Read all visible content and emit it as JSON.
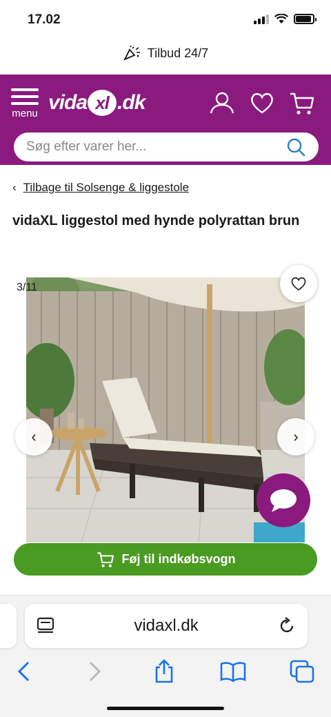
{
  "status_bar": {
    "time": "17.02",
    "battery_level": 0.9
  },
  "promo": {
    "text": "Tilbud 24/7"
  },
  "header": {
    "menu_label": "menu",
    "logo_text_left": "vida",
    "logo_text_xl": "xl",
    "logo_text_right": ".dk",
    "brand_color": "#8a1a7e",
    "icons": [
      "account-icon",
      "heart-icon",
      "cart-icon"
    ]
  },
  "search": {
    "placeholder": "Søg efter varer her..."
  },
  "breadcrumb": {
    "label": "Tilbage til Solsenge & liggestole"
  },
  "product": {
    "title": "vidaXL liggestol med hynde polyrattan brun",
    "image_counter": "3/11"
  },
  "actions": {
    "add_to_cart": "Føj til indkøbsvogn",
    "cart_button_color": "#4a9b22"
  },
  "browser": {
    "url": "vidaxl.dk"
  }
}
